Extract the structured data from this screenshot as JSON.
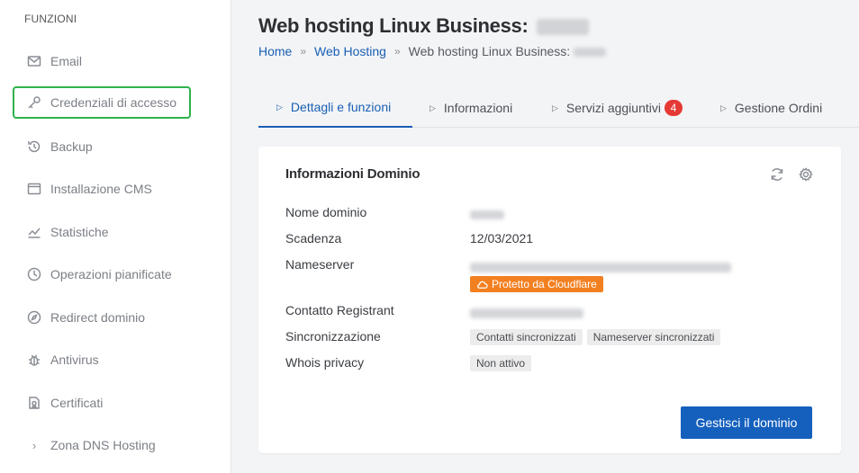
{
  "sidebar": {
    "title": "FUNZIONI",
    "items": [
      {
        "label": "Email",
        "icon": "mail-icon"
      },
      {
        "label": "Credenziali di accesso",
        "icon": "key-icon"
      },
      {
        "label": "Backup",
        "icon": "history-icon"
      },
      {
        "label": "Installazione CMS",
        "icon": "window-icon"
      },
      {
        "label": "Statistiche",
        "icon": "chart-icon"
      },
      {
        "label": "Operazioni pianificate",
        "icon": "clock-icon"
      },
      {
        "label": "Redirect dominio",
        "icon": "compass-icon"
      },
      {
        "label": "Antivirus",
        "icon": "bug-icon"
      },
      {
        "label": "Certificati",
        "icon": "certificate-icon"
      },
      {
        "label": "Zona DNS Hosting",
        "icon": "chevron-right-icon"
      }
    ]
  },
  "header": {
    "title": "Web hosting Linux Business:",
    "breadcrumb": {
      "home": "Home",
      "separator": "»",
      "section": "Web Hosting",
      "current": "Web hosting Linux Business:"
    }
  },
  "tabs": [
    {
      "label": "Dettagli e funzioni"
    },
    {
      "label": "Informazioni"
    },
    {
      "label": "Servizi aggiuntivi",
      "badge": "4"
    },
    {
      "label": "Gestione Ordini"
    }
  ],
  "card": {
    "title": "Informazioni Dominio",
    "rows": {
      "domain_name": {
        "label": "Nome dominio"
      },
      "expiry": {
        "label": "Scadenza",
        "value": "12/03/2021"
      },
      "nameserver": {
        "label": "Nameserver",
        "tag": "Protetto da Cloudflare"
      },
      "registrant": {
        "label": "Contatto Registrant"
      },
      "sync": {
        "label": "Sincronizzazione",
        "tags": [
          "Contatti sincronizzati",
          "Nameserver sincronizzati"
        ]
      },
      "whois": {
        "label": "Whois privacy",
        "tag": "Non attivo"
      }
    },
    "button": "Gestisci il dominio"
  },
  "colors": {
    "accent": "#1560bd",
    "active_outline": "#2fb24a",
    "badge": "#e53935",
    "cloudflare": "#f38020"
  }
}
